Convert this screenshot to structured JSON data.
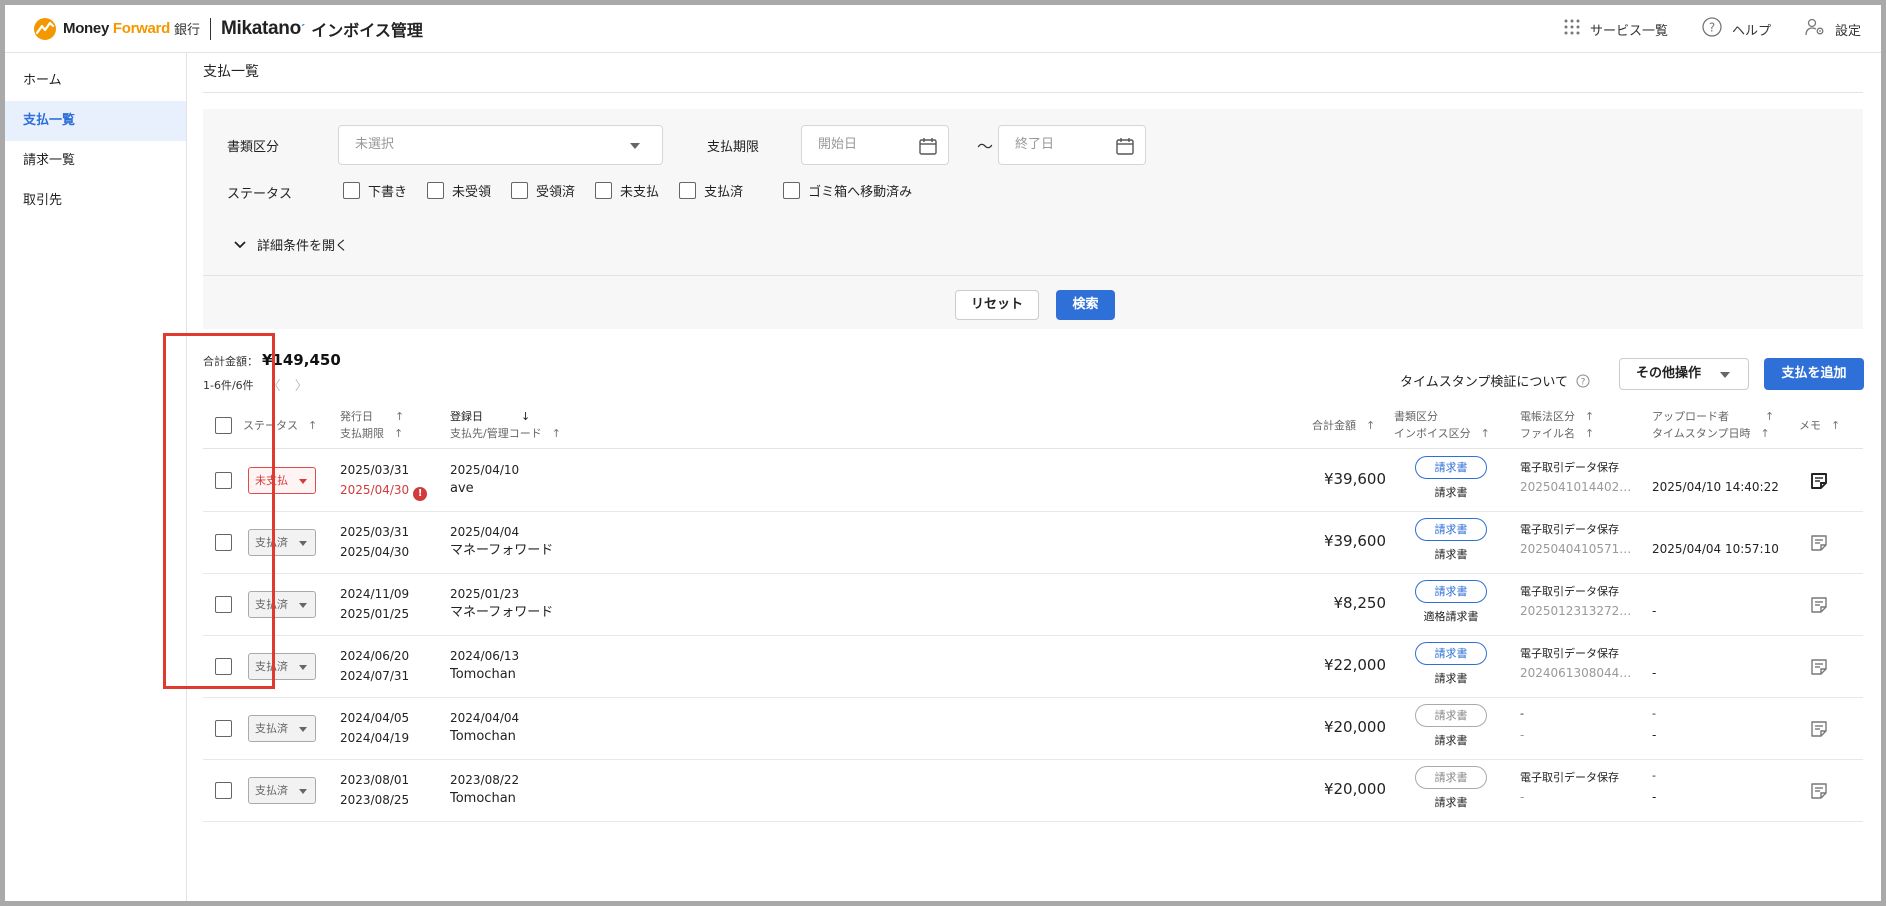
{
  "header": {
    "logo_mf": "Money ",
    "logo_fw": "Forward",
    "logo_bank": "銀行",
    "logo_mikatano": "Mikatano",
    "logo_app": "インボイス管理",
    "services_label": "サービス一覧",
    "help_label": "ヘルプ",
    "settings_label": "設定"
  },
  "sidebar": {
    "items": [
      {
        "label": "ホーム",
        "active": false
      },
      {
        "label": "支払一覧",
        "active": true
      },
      {
        "label": "請求一覧",
        "active": false
      },
      {
        "label": "取引先",
        "active": false
      }
    ]
  },
  "page": {
    "title": "支払一覧"
  },
  "filter": {
    "doc_type_label": "書類区分",
    "doc_type_placeholder": "未選択",
    "due_label": "支払期限",
    "start_placeholder": "開始日",
    "tilde": "〜",
    "end_placeholder": "終了日",
    "status_label": "ステータス",
    "statuses": [
      "下書き",
      "未受領",
      "受領済",
      "未支払",
      "支払済",
      "ゴミ箱へ移動済み"
    ],
    "detail_toggle": "詳細条件を開く",
    "reset_label": "リセット",
    "search_label": "検索"
  },
  "summary": {
    "total_label": "合計金額：",
    "total_value": "¥149,450",
    "count_text": "1-6件/6件",
    "prev": "〈",
    "next": "〉",
    "timestamp_link": "タイムスタンプ検証について",
    "other_ops": "その他操作",
    "add_payment": "支払を追加"
  },
  "table": {
    "headers": {
      "status": "ステータス",
      "issue_date": "発行日",
      "due_date": "支払期限",
      "reg_date": "登録日",
      "payee": "支払先/管理コード",
      "amount": "合計金額",
      "doc_type": "書類区分",
      "invoice_type": "インボイス区分",
      "ebook_type": "電帳法区分",
      "file_name": "ファイル名",
      "uploader": "アップロード者",
      "timestamp": "タイムスタンプ日時",
      "memo": "メモ"
    },
    "rows": [
      {
        "status": "未支払",
        "status_kind": "unpaid",
        "issue": "2025/03/31",
        "due": "2025/04/30",
        "due_overdue": true,
        "reg": "2025/04/10",
        "payee": "ave",
        "amount": "¥39,600",
        "doc": "請求書",
        "doc_active": true,
        "invoice": "請求書",
        "ebook": "電子取引データ保存",
        "file": "2025041014402…",
        "uploader": "",
        "ts": "2025/04/10 14:40:22",
        "memo_filled": true
      },
      {
        "status": "支払済",
        "status_kind": "paid",
        "issue": "2025/03/31",
        "due": "2025/04/30",
        "due_overdue": false,
        "reg": "2025/04/04",
        "payee": "マネーフォワード",
        "amount": "¥39,600",
        "doc": "請求書",
        "doc_active": true,
        "invoice": "請求書",
        "ebook": "電子取引データ保存",
        "file": "2025040410571…",
        "uploader": "",
        "ts": "2025/04/04 10:57:10",
        "memo_filled": false
      },
      {
        "status": "支払済",
        "status_kind": "paid",
        "issue": "2024/11/09",
        "due": "2025/01/25",
        "due_overdue": false,
        "reg": "2025/01/23",
        "payee": "マネーフォワード",
        "amount": "¥8,250",
        "doc": "請求書",
        "doc_active": true,
        "invoice": "適格請求書",
        "ebook": "電子取引データ保存",
        "file": "2025012313272…",
        "uploader": "",
        "ts": "-",
        "memo_filled": false
      },
      {
        "status": "支払済",
        "status_kind": "paid",
        "issue": "2024/06/20",
        "due": "2024/07/31",
        "due_overdue": false,
        "reg": "2024/06/13",
        "payee": "Tomochan",
        "amount": "¥22,000",
        "doc": "請求書",
        "doc_active": true,
        "invoice": "請求書",
        "ebook": "電子取引データ保存",
        "file": "2024061308044…",
        "uploader": "",
        "ts": "-",
        "memo_filled": false
      },
      {
        "status": "支払済",
        "status_kind": "paid",
        "issue": "2024/04/05",
        "due": "2024/04/19",
        "due_overdue": false,
        "reg": "2024/04/04",
        "payee": "Tomochan",
        "amount": "¥20,000",
        "doc": "請求書",
        "doc_active": false,
        "invoice": "請求書",
        "ebook": "-",
        "file": "-",
        "uploader": "-",
        "ts": "-",
        "memo_filled": false
      },
      {
        "status": "支払済",
        "status_kind": "paid",
        "issue": "2023/08/01",
        "due": "2023/08/25",
        "due_overdue": false,
        "reg": "2023/08/22",
        "payee": "Tomochan",
        "amount": "¥20,000",
        "doc": "請求書",
        "doc_active": false,
        "invoice": "請求書",
        "ebook": "電子取引データ保存",
        "file": "-",
        "uploader": "-",
        "ts": "-",
        "memo_filled": false
      }
    ]
  },
  "colors": {
    "accent": "#2f6fd8",
    "danger": "#d23b3b",
    "highlight_box": "#e03a2f",
    "brand_orange": "#f39800"
  }
}
